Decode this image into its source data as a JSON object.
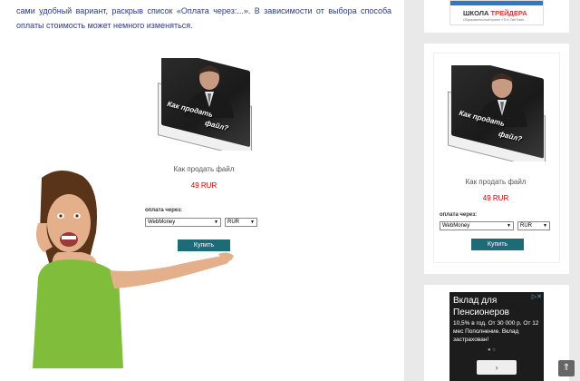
{
  "article": {
    "intro_text": "сами удобный вариант, раскрыв список «Оплата через:...». В зависимости от выбора способа оплаты стоимость может немного изменяться."
  },
  "ebook_cover": {
    "title_line1": "Как продать",
    "title_line2": "файл?"
  },
  "purchase_widget": {
    "product_name": "Как продать файл",
    "price": "49 RUR",
    "payment_label": "оплата через:",
    "payment_method": "WebMoney",
    "currency": "RUR",
    "buy_label": "Купить"
  },
  "sidebar": {
    "top_ad": {
      "brand": "ШКОЛА",
      "brand_accent": "ТРЕЙДЕРА",
      "sub": "Образовательный проект «ТН» TeleTrade"
    },
    "ebook_cover": {
      "title_line1": "Как продать",
      "title_line2": "файл?"
    },
    "purchase_widget": {
      "product_name": "Как продать файл",
      "price": "49 RUR",
      "payment_label": "оплата через:",
      "payment_method": "WebMoney",
      "currency": "RUR",
      "buy_label": "Купить"
    },
    "bottom_ad": {
      "heading": "Вклад для Пенсионеров",
      "body": "10,5% в год. От 30 000 р. От 12 мес Пополнение. Вклад застрахован!",
      "dots": "● ○",
      "next": "›",
      "close": "▷✕"
    }
  },
  "scroll_top_label": "⇑",
  "colors": {
    "text_link": "#2a3f7a",
    "price": "#cc0000",
    "buy_button": "#1e6b78",
    "page_bg": "#e9e9e9"
  }
}
